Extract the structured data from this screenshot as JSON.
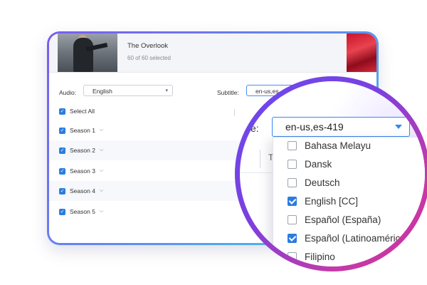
{
  "header": {
    "title": "The Overlook",
    "selected_count": "60 of 60 selected"
  },
  "options": {
    "audio_label": "Audio:",
    "audio_value": "English",
    "subtitle_label": "Subtitle:",
    "subtitle_value": "en-us,es"
  },
  "list": {
    "select_all": "Select All",
    "seasons": [
      {
        "label": "Season 1"
      },
      {
        "label": "Season 2"
      },
      {
        "label": "Season 3"
      },
      {
        "label": "Season 4"
      },
      {
        "label": "Season 5"
      }
    ]
  },
  "magnifier": {
    "label_fragment": "e:",
    "subtitle_value": "en-us,es-419",
    "column_fragment": "T",
    "languages": [
      {
        "label": "Bahasa Melayu",
        "checked": false
      },
      {
        "label": "Dansk",
        "checked": false
      },
      {
        "label": "Deutsch",
        "checked": false
      },
      {
        "label": "English [CC]",
        "checked": true
      },
      {
        "label": "Español (España)",
        "checked": false
      },
      {
        "label": "Español (Latinoaméric",
        "checked": true
      },
      {
        "label": "Filipino",
        "checked": false
      }
    ]
  },
  "colors": {
    "accent": "#2a7de1",
    "ring_start": "#6a4bef",
    "ring_end": "#d2309b"
  }
}
